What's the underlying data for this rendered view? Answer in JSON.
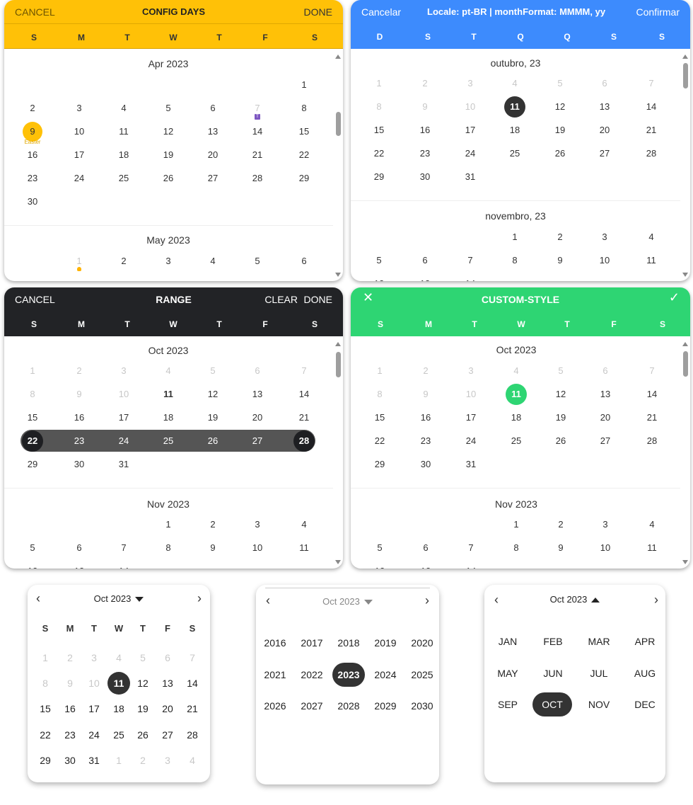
{
  "colors": {
    "yellow": "#ffc107",
    "blue": "#3d8bfd",
    "dark": "#222326",
    "green": "#2ed573",
    "selected": "#333333"
  },
  "p1": {
    "cancel": "CANCEL",
    "title": "CONFIG DAYS",
    "done": "DONE",
    "weekdays": [
      "S",
      "M",
      "T",
      "W",
      "T",
      "F",
      "S"
    ],
    "month1": "Apr 2023",
    "month2": "May 2023",
    "easter_label": "Easter",
    "badge_label": "T",
    "marker_icon": "person-icon"
  },
  "p2": {
    "cancel": "Cancelar",
    "title": "Locale: pt-BR | monthFormat: MMMM, yy",
    "done": "Confirmar",
    "weekdays": [
      "D",
      "S",
      "T",
      "Q",
      "Q",
      "S",
      "S"
    ],
    "month1": "outubro, 23",
    "month2": "novembro, 23"
  },
  "p3": {
    "cancel": "CANCEL",
    "title": "RANGE",
    "clear": "CLEAR",
    "done": "DONE",
    "weekdays": [
      "S",
      "M",
      "T",
      "W",
      "T",
      "F",
      "S"
    ],
    "month1": "Oct 2023",
    "month2": "Nov 2023",
    "range": [
      22,
      28
    ]
  },
  "p4": {
    "close_icon": "close-icon",
    "title": "CUSTOM-STYLE",
    "check_icon": "check-icon",
    "weekdays": [
      "S",
      "M",
      "T",
      "W",
      "T",
      "F",
      "S"
    ],
    "month1": "Oct 2023",
    "month2": "Nov 2023"
  },
  "c1": {
    "title": "Oct 2023",
    "weekdays": [
      "S",
      "M",
      "T",
      "W",
      "T",
      "F",
      "S"
    ]
  },
  "c2": {
    "title": "Oct 2023",
    "years": [
      "2016",
      "2017",
      "2018",
      "2019",
      "2020",
      "2021",
      "2022",
      "2023",
      "2024",
      "2025",
      "2026",
      "2027",
      "2028",
      "2029",
      "2030"
    ],
    "selected": "2023"
  },
  "c3": {
    "title": "Oct 2023",
    "months": [
      "JAN",
      "FEB",
      "MAR",
      "APR",
      "MAY",
      "JUN",
      "JUL",
      "AUG",
      "SEP",
      "OCT",
      "NOV",
      "DEC"
    ],
    "selected": "OCT"
  }
}
